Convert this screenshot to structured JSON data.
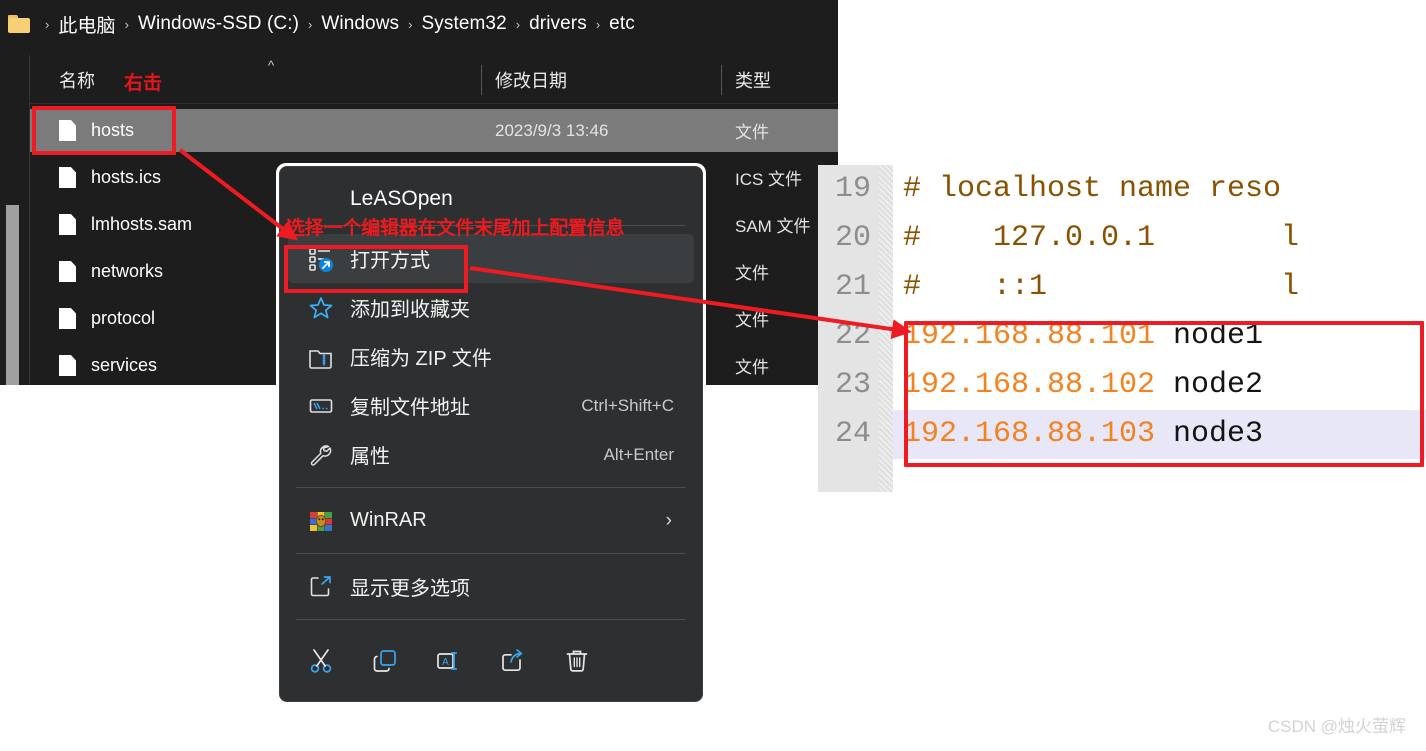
{
  "explorer": {
    "breadcrumb": {
      "icon": "folder-icon",
      "separator": "›",
      "items": [
        "此电脑",
        "Windows-SSD (C:)",
        "Windows",
        "System32",
        "drivers",
        "etc"
      ]
    },
    "columns": [
      {
        "label": "名称"
      },
      {
        "label": "修改日期"
      },
      {
        "label": "类型"
      }
    ],
    "sort_caret": "^",
    "annotation_rightclick": "右击",
    "rows": [
      {
        "name": "hosts",
        "date": "2023/9/3 13:46",
        "type": "文件",
        "selected": true
      },
      {
        "name": "hosts.ics",
        "date": "",
        "type": "ICS 文件",
        "selected": false
      },
      {
        "name": "lmhosts.sam",
        "date": "",
        "type": "SAM 文件",
        "selected": false
      },
      {
        "name": "networks",
        "date": "",
        "type": "文件",
        "selected": false
      },
      {
        "name": "protocol",
        "date": "",
        "type": "文件",
        "selected": false
      },
      {
        "name": "services",
        "date": "",
        "type": "文件",
        "selected": false
      }
    ]
  },
  "context_menu": {
    "title": "LeASOpen",
    "annotation": "选择一个编辑器在文件末尾加上配置信息",
    "items": [
      {
        "label": "打开方式",
        "accel": "",
        "icon": "open-with-icon",
        "hovered": true,
        "chevron": false
      },
      {
        "label": "添加到收藏夹",
        "accel": "",
        "icon": "star-icon",
        "hovered": false,
        "chevron": false
      },
      {
        "label": "压缩为 ZIP 文件",
        "accel": "",
        "icon": "zip-icon",
        "hovered": false,
        "chevron": false
      },
      {
        "label": "复制文件地址",
        "accel": "Ctrl+Shift+C",
        "icon": "copy-path-icon",
        "hovered": false,
        "chevron": false
      },
      {
        "label": "属性",
        "accel": "Alt+Enter",
        "icon": "wrench-icon",
        "hovered": false,
        "chevron": false
      },
      {
        "label": "WinRAR",
        "accel": "",
        "icon": "winrar-icon",
        "hovered": false,
        "chevron": true
      },
      {
        "label": "显示更多选项",
        "accel": "",
        "icon": "more-options-icon",
        "hovered": false,
        "chevron": false
      }
    ],
    "action_icons": [
      "cut-icon",
      "copy-icon",
      "rename-icon",
      "share-icon",
      "delete-icon"
    ]
  },
  "code_panel": {
    "lines": [
      {
        "num": "19",
        "kind": "comment",
        "text": "# localhost name reso",
        "ip": "",
        "host": "",
        "current": false
      },
      {
        "num": "20",
        "kind": "comment",
        "text": "#    127.0.0.1       l",
        "ip": "",
        "host": "",
        "current": false
      },
      {
        "num": "21",
        "kind": "comment",
        "text": "#    ::1             l",
        "ip": "",
        "host": "",
        "current": false
      },
      {
        "num": "22",
        "kind": "entry",
        "text": "",
        "ip": "192.168.88.101",
        "host": " node1",
        "current": false
      },
      {
        "num": "23",
        "kind": "entry",
        "text": "",
        "ip": "192.168.88.102",
        "host": " node2",
        "current": false
      },
      {
        "num": "24",
        "kind": "entry",
        "text": "",
        "ip": "192.168.88.103",
        "host": " node3",
        "current": true
      }
    ]
  },
  "watermark": "CSDN @烛火萤辉",
  "colors": {
    "annotation_red": "#ee1b22",
    "ip_orange": "#f58220",
    "comment_brown": "#8a5200",
    "current_line": "#e7e7f8",
    "menu_bg": "#2d2f31",
    "explorer_bg": "#1d1d1d"
  }
}
